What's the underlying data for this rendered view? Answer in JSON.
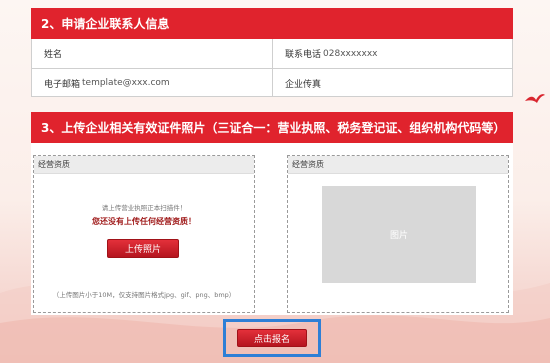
{
  "section2": {
    "title": "2、申请企业联系人信息"
  },
  "contact": {
    "name_label": "姓名",
    "phone_label": "联系电话",
    "phone_value": "028xxxxxxx",
    "email_label": "电子邮箱",
    "email_value": "template@xxx.com",
    "fax_label": "企业传真"
  },
  "section3": {
    "title": "3、上传企业相关有效证件照片（三证合一：营业执照、税务登记证、组织机构代码等）"
  },
  "upload_left": {
    "title": "经营资质",
    "hint": "请上传营业执照正本扫描件！",
    "warning": "您还没有上传任何经营资质！",
    "button": "上传照片",
    "note": "（上传图片小于10M，仅支持图片格式jpg、gif、png、bmp）"
  },
  "upload_right": {
    "title": "经营资质",
    "image_label": "图片"
  },
  "submit": {
    "label": "点击报名"
  },
  "colors": {
    "accent_red": "#e0232d",
    "highlight_blue": "#2e7fd6"
  }
}
